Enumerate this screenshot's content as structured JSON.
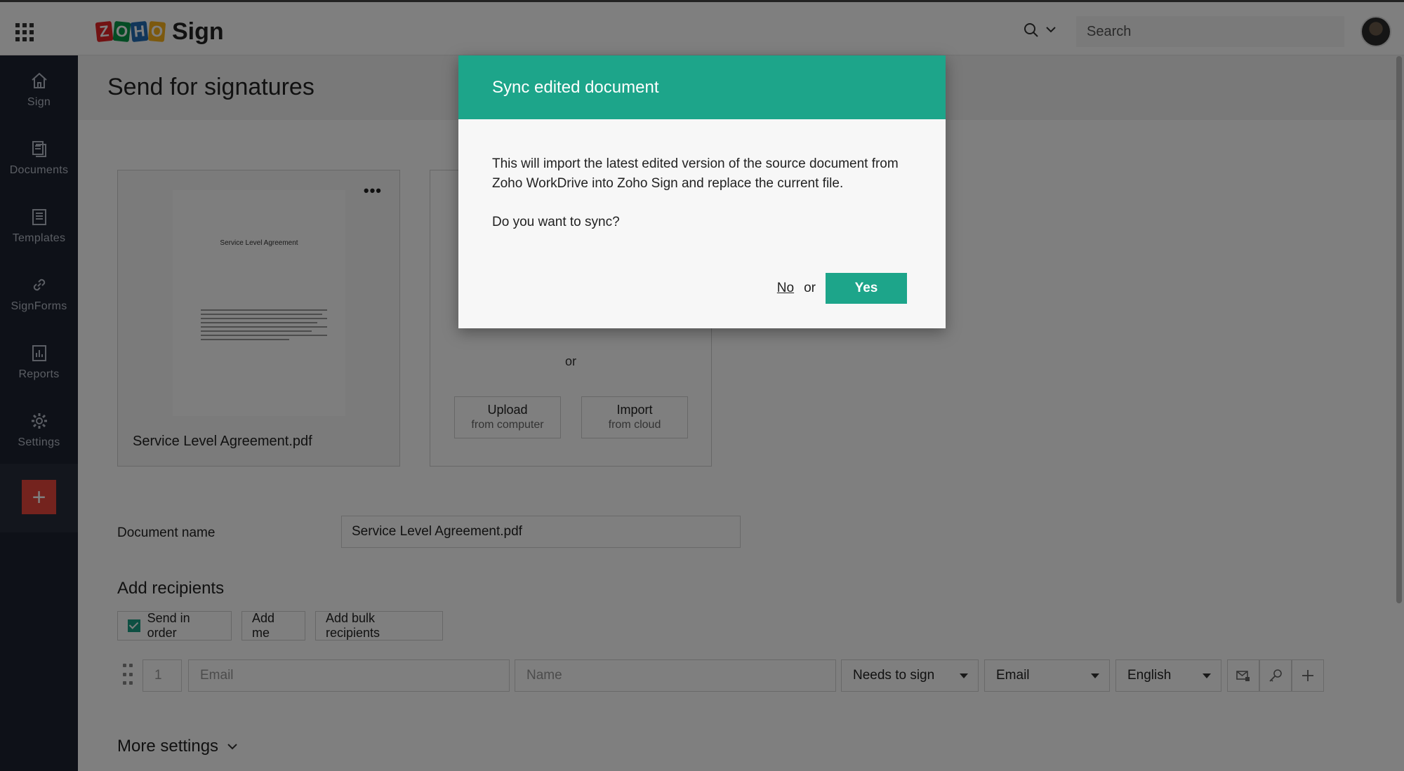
{
  "app": {
    "brand_letters": [
      "Z",
      "O",
      "H",
      "O"
    ],
    "product_name": "Sign"
  },
  "header": {
    "search_placeholder": "Search"
  },
  "sidebar": {
    "items": [
      {
        "label": "Sign",
        "icon": "home-icon"
      },
      {
        "label": "Documents",
        "icon": "documents-icon"
      },
      {
        "label": "Templates",
        "icon": "templates-icon"
      },
      {
        "label": "SignForms",
        "icon": "link-icon"
      },
      {
        "label": "Reports",
        "icon": "reports-icon"
      },
      {
        "label": "Settings",
        "icon": "gear-icon"
      }
    ],
    "new_button": "+"
  },
  "page": {
    "title": "Send for signatures"
  },
  "document": {
    "thumbnail_title": "Service Level Agreement",
    "file_name": "Service Level Agreement.pdf",
    "more_menu": "•••"
  },
  "upload": {
    "or_text": "or",
    "upload_main": "Upload",
    "upload_sub": "from computer",
    "import_main": "Import",
    "import_sub": "from cloud"
  },
  "form": {
    "document_name_label": "Document name",
    "document_name_value": "Service Level Agreement.pdf",
    "add_recipients_title": "Add recipients",
    "send_in_order": "Send in order",
    "add_me": "Add me",
    "add_bulk": "Add bulk recipients",
    "recipient": {
      "order": "1",
      "email_placeholder": "Email",
      "name_placeholder": "Name",
      "role": "Needs to sign",
      "delivery": "Email",
      "language": "English"
    },
    "more_settings": "More settings"
  },
  "dialog": {
    "title": "Sync edited document",
    "message": "This will import the latest edited version of the source document from Zoho WorkDrive into Zoho Sign and replace the current file.",
    "question": "Do you want to sync?",
    "no_label": "No",
    "or_label": "or",
    "yes_label": "Yes"
  },
  "colors": {
    "accent": "#1da58a",
    "sidebar_bg": "#1d2330",
    "new_button": "#e8473c"
  }
}
